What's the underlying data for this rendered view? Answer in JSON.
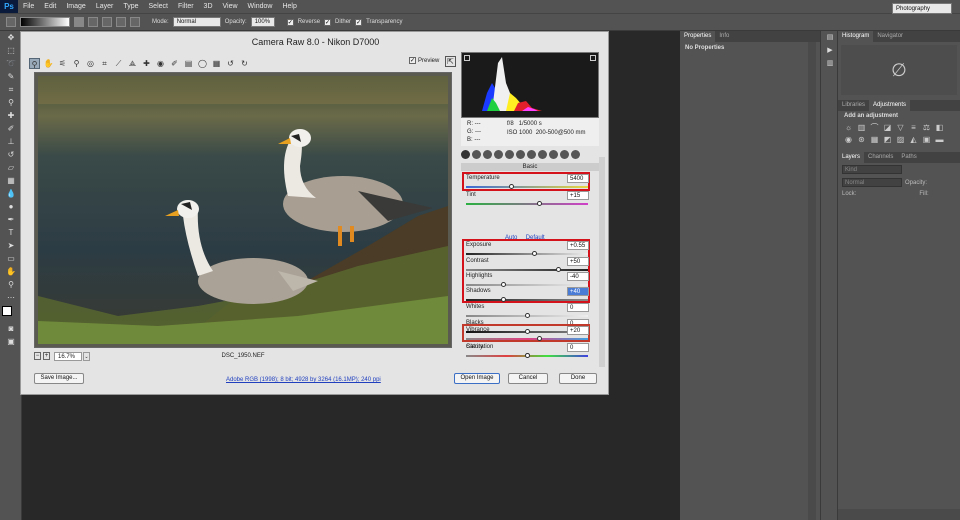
{
  "app_logo": "Ps",
  "menu": [
    "File",
    "Edit",
    "Image",
    "Layer",
    "Type",
    "Select",
    "Filter",
    "3D",
    "View",
    "Window",
    "Help"
  ],
  "options_bar": {
    "mode_label": "Mode:",
    "mode_value": "Normal",
    "opacity_label": "Opacity:",
    "opacity_value": "100%",
    "reverse": "Reverse",
    "dither": "Dither",
    "transparency": "Transparency",
    "workspace": "Photography"
  },
  "dialog": {
    "title": "Camera Raw 8.0  -  Nikon D7000",
    "preview_label": "Preview",
    "filename": "DSC_1950.NEF",
    "zoom": "16.7%",
    "camera_info": {
      "r": "R:",
      "g": "G:",
      "b": "B:",
      "dash": "---",
      "aperture": "f/8",
      "shutter": "1/5000 s",
      "iso": "ISO 1000",
      "lens": "200-500@500 mm"
    },
    "panel_name": "Basic",
    "auto_label": "Auto",
    "default_label": "Default",
    "controls": {
      "temperature": {
        "label": "Temperature",
        "value": "5400",
        "pos": 0.37
      },
      "tint": {
        "label": "Tint",
        "value": "+15",
        "pos": 0.6
      },
      "exposure": {
        "label": "Exposure",
        "value": "+0.55",
        "pos": 0.56
      },
      "contrast": {
        "label": "Contrast",
        "value": "+50",
        "pos": 0.75
      },
      "highlights": {
        "label": "Highlights",
        "value": "-40",
        "pos": 0.3
      },
      "shadows": {
        "label": "Shadows",
        "value": "+40",
        "pos": 0.3
      },
      "whites": {
        "label": "Whites",
        "value": "0",
        "pos": 0.5
      },
      "blacks": {
        "label": "Blacks",
        "value": "0",
        "pos": 0.5
      },
      "clarity": {
        "label": "Clarity",
        "value": "0",
        "pos": 0.5
      },
      "vibrance": {
        "label": "Vibrance",
        "value": "+20",
        "pos": 0.6
      },
      "saturation": {
        "label": "Saturation",
        "value": "0",
        "pos": 0.5
      }
    },
    "status_link": "Adobe RGB (1998); 8 bit; 4928 by 3264 (16.1MP); 240 ppi",
    "buttons": {
      "save": "Save Image...",
      "open": "Open Image",
      "cancel": "Cancel",
      "done": "Done"
    }
  },
  "properties_panel": {
    "tab1": "Properties",
    "tab2": "Info",
    "message": "No Properties"
  },
  "histogram_panel": {
    "tab1": "Histogram",
    "tab2": "Navigator"
  },
  "adjustments_panel": {
    "tab1": "Libraries",
    "tab2": "Adjustments",
    "heading": "Add an adjustment"
  },
  "layers_panel": {
    "tab1": "Layers",
    "tab2": "Channels",
    "tab3": "Paths",
    "kind": "Kind",
    "blend": "Normal",
    "opacity_label": "Opacity:",
    "lock_label": "Lock:",
    "fill_label": "Fill:"
  },
  "colors": {
    "accent_red": "#d4121c",
    "link_blue": "#1f3fbf"
  }
}
